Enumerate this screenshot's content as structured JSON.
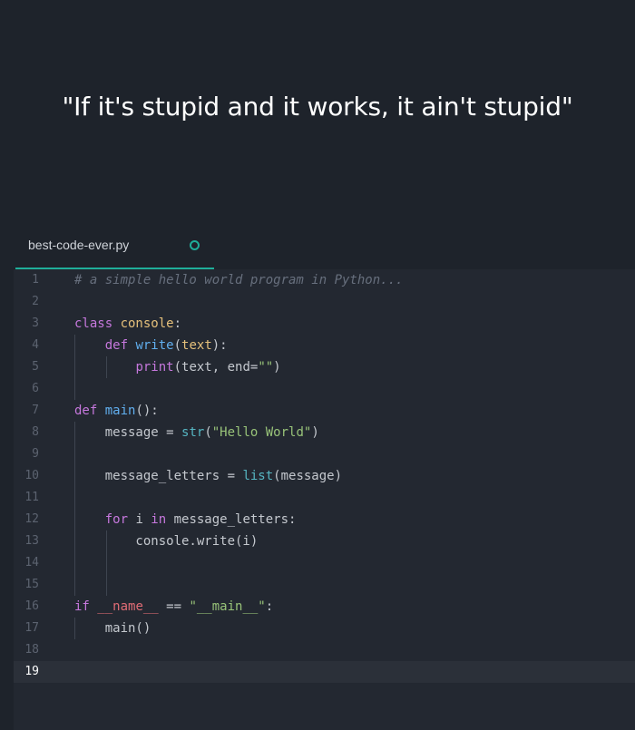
{
  "quote": "\"If it's stupid and it works, it ain't stupid\"",
  "tab": {
    "filename": "best-code-ever.py"
  },
  "editor": {
    "current_line": 19,
    "lines": [
      {
        "n": "1",
        "tokens": [
          {
            "t": "# a simple hello world program in Python...",
            "c": "c"
          }
        ]
      },
      {
        "n": "2",
        "tokens": []
      },
      {
        "n": "3",
        "tokens": [
          {
            "t": "class ",
            "c": "k"
          },
          {
            "t": "console",
            "c": "p"
          },
          {
            "t": ":",
            "c": ""
          }
        ]
      },
      {
        "n": "4",
        "tokens": [
          {
            "t": "    ",
            "c": ""
          },
          {
            "t": "def ",
            "c": "k"
          },
          {
            "t": "write",
            "c": "f"
          },
          {
            "t": "(",
            "c": ""
          },
          {
            "t": "text",
            "c": "p"
          },
          {
            "t": "):",
            "c": ""
          }
        ]
      },
      {
        "n": "5",
        "tokens": [
          {
            "t": "        ",
            "c": ""
          },
          {
            "t": "print",
            "c": "k"
          },
          {
            "t": "(text, end=",
            "c": ""
          },
          {
            "t": "\"\"",
            "c": "s"
          },
          {
            "t": ")",
            "c": ""
          }
        ]
      },
      {
        "n": "6",
        "tokens": []
      },
      {
        "n": "7",
        "tokens": [
          {
            "t": "def ",
            "c": "k"
          },
          {
            "t": "main",
            "c": "f"
          },
          {
            "t": "():",
            "c": ""
          }
        ]
      },
      {
        "n": "8",
        "tokens": [
          {
            "t": "    message = ",
            "c": ""
          },
          {
            "t": "str",
            "c": "b"
          },
          {
            "t": "(",
            "c": ""
          },
          {
            "t": "\"Hello World\"",
            "c": "s"
          },
          {
            "t": ")",
            "c": ""
          }
        ]
      },
      {
        "n": "9",
        "tokens": []
      },
      {
        "n": "10",
        "tokens": [
          {
            "t": "    message_letters = ",
            "c": ""
          },
          {
            "t": "list",
            "c": "b"
          },
          {
            "t": "(message)",
            "c": ""
          }
        ]
      },
      {
        "n": "11",
        "tokens": []
      },
      {
        "n": "12",
        "tokens": [
          {
            "t": "    ",
            "c": ""
          },
          {
            "t": "for ",
            "c": "k"
          },
          {
            "t": "i ",
            "c": ""
          },
          {
            "t": "in ",
            "c": "k"
          },
          {
            "t": "message_letters:",
            "c": ""
          }
        ]
      },
      {
        "n": "13",
        "tokens": [
          {
            "t": "        console.write(i)",
            "c": ""
          }
        ]
      },
      {
        "n": "14",
        "tokens": []
      },
      {
        "n": "15",
        "tokens": []
      },
      {
        "n": "16",
        "tokens": [
          {
            "t": "if ",
            "c": "k"
          },
          {
            "t": "__name__",
            "c": "d"
          },
          {
            "t": " == ",
            "c": ""
          },
          {
            "t": "\"__main__\"",
            "c": "s"
          },
          {
            "t": ":",
            "c": ""
          }
        ]
      },
      {
        "n": "17",
        "tokens": [
          {
            "t": "    main()",
            "c": ""
          }
        ]
      },
      {
        "n": "18",
        "tokens": []
      },
      {
        "n": "19",
        "tokens": []
      }
    ]
  }
}
